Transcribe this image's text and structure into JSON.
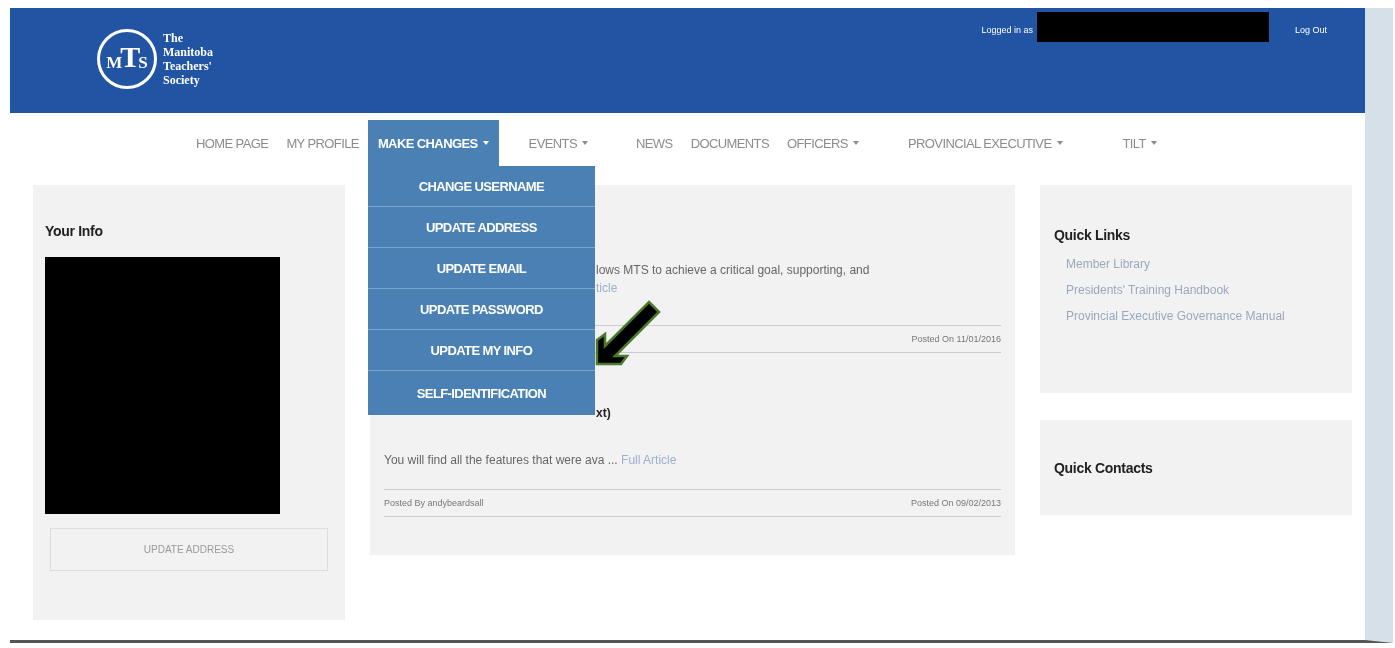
{
  "header": {
    "logo": {
      "monogram": [
        "M",
        "T",
        "S"
      ],
      "name_lines": [
        "The",
        "Manitoba",
        "Teachers'",
        "Society"
      ]
    },
    "logged_in_label": "Logged in as",
    "logout": "Log Out"
  },
  "nav": [
    {
      "label": "HOME PAGE",
      "has_caret": false,
      "selected": false
    },
    {
      "label": "MY PROFILE",
      "has_caret": false,
      "selected": false
    },
    {
      "label": "MAKE CHANGES",
      "has_caret": true,
      "selected": true,
      "dropdown": [
        "CHANGE USERNAME",
        "UPDATE ADDRESS",
        "UPDATE EMAIL",
        "UPDATE PASSWORD",
        "UPDATE MY INFO",
        "SELF-IDENTIFICATION"
      ]
    },
    {
      "label": "EVENTS",
      "has_caret": true,
      "selected": false
    },
    {
      "label": "NEWS",
      "has_caret": false,
      "selected": false
    },
    {
      "label": "DOCUMENTS",
      "has_caret": false,
      "selected": false
    },
    {
      "label": "OFFICERS",
      "has_caret": true,
      "selected": false
    },
    {
      "label": "PROVINCIAL EXECUTIVE",
      "has_caret": true,
      "selected": false
    },
    {
      "label": "TILT",
      "has_caret": true,
      "selected": false
    }
  ],
  "your_info": {
    "title": "Your Info",
    "button": "UPDATE ADDRESS"
  },
  "articles": [
    {
      "excerpt": "lows MTS to achieve a critical goal, supporting, and",
      "link": "ticle",
      "posted_on": "Posted On 11/01/2016"
    },
    {
      "title": "xt)",
      "excerpt": "You will find all the features that were ava ...",
      "link": "Full Article",
      "posted_by": "Posted By andybeardsall",
      "posted_on": "Posted On 09/02/2013"
    }
  ],
  "quick_links": {
    "title": "Quick Links",
    "links": [
      "Member Library",
      "Presidents' Training Handbook",
      "Provincial Executive Governance Manual"
    ]
  },
  "quick_contacts": {
    "title": "Quick Contacts"
  }
}
